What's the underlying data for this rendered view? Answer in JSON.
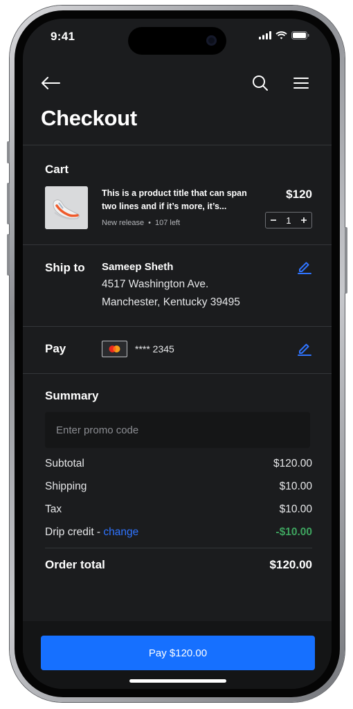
{
  "status_bar": {
    "time": "9:41"
  },
  "header": {
    "title": "Checkout"
  },
  "cart": {
    "label": "Cart",
    "item": {
      "title": "This is a product title that can span two lines and if it’s more, it’s...",
      "tag": "New release",
      "stock": "107 left",
      "price": "$120",
      "quantity": "1"
    }
  },
  "ship": {
    "label": "Ship to",
    "name": "Sameep Sheth",
    "address_line1": "4517 Washington Ave.",
    "address_line2": "Manchester, Kentucky 39495"
  },
  "pay": {
    "label": "Pay",
    "card_masked": "**** 2345"
  },
  "summary": {
    "label": "Summary",
    "promo_placeholder": "Enter promo code",
    "rows": [
      {
        "label": "Subtotal",
        "value": "$120.00"
      },
      {
        "label": "Shipping",
        "value": "$10.00"
      },
      {
        "label": "Tax",
        "value": "$10.00"
      }
    ],
    "credit": {
      "label": "Drip credit - ",
      "link": "change",
      "value": "-$10.00"
    },
    "total": {
      "label": "Order total",
      "value": "$120.00"
    }
  },
  "cta": {
    "label": "Pay $120.00"
  },
  "colors": {
    "accent": "#1670ff",
    "link": "#2f74ff",
    "credit": "#3ea45f",
    "background": "#1b1c1e"
  },
  "icons": [
    "back-arrow-icon",
    "search-icon",
    "menu-icon",
    "minus-icon",
    "plus-icon",
    "edit-pencil-icon",
    "mastercard-icon",
    "signal-icon",
    "wifi-icon",
    "battery-icon"
  ]
}
